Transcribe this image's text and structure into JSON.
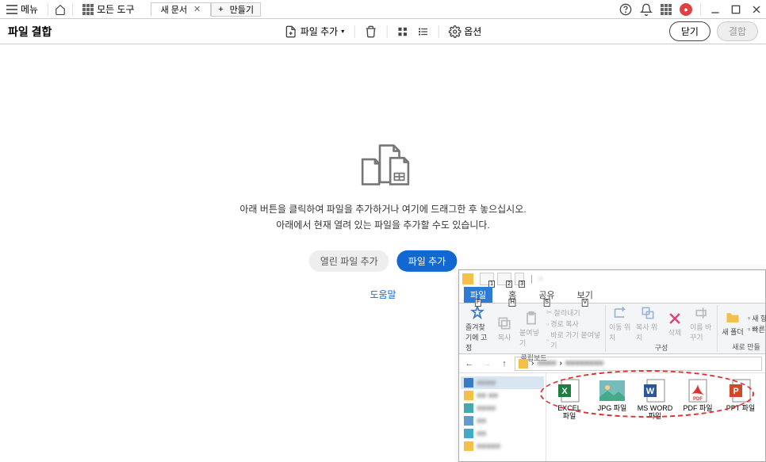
{
  "menubar": {
    "menu_label": "메뉴",
    "all_tools": "모든 도구",
    "tab_active": "새 문서",
    "tab_add": "만들기"
  },
  "toolbar": {
    "title": "파일 결합",
    "add_file": "파일 추가",
    "options": "옵션",
    "close": "닫기",
    "combine": "결합"
  },
  "empty": {
    "line1": "아래 버튼을 클릭하여 파일을 추가하거나 여기에 드래그한 후 놓으십시오.",
    "line2": "아래에서 현재 열려 있는 파일을 추가할 수도 있습니다.",
    "open_files": "열린 파일 추가",
    "add_file": "파일 추가",
    "help": "도움말"
  },
  "explorer": {
    "qat_keys": [
      "1",
      "2",
      "3"
    ],
    "title_sep": "|",
    "ribbon_tabs": {
      "file": "파일",
      "home": "홈",
      "share": "공유",
      "view": "보기",
      "keys": [
        "F",
        "H",
        "S",
        "V"
      ]
    },
    "ribbon": {
      "pin": "즐겨찾기에 고정",
      "copy": "복사",
      "paste": "붙여넣기",
      "cut": "잘라내기",
      "copy_path": "경로 복사",
      "paste_shortcut": "바로 가기 붙여넣기",
      "clipboard_group": "클립보드",
      "move_to": "이동 위치",
      "copy_to": "복사 위치",
      "delete": "삭제",
      "rename": "이름 바꾸기",
      "organize_group": "구성",
      "new_folder": "새 폴더",
      "new_item": "새 항",
      "quick": "빠른",
      "new_group": "새로 만들"
    },
    "files": [
      {
        "name": "EXCEL 파일",
        "type": "excel"
      },
      {
        "name": "JPG 파일",
        "type": "jpg"
      },
      {
        "name": "MS WORD 파일",
        "type": "word"
      },
      {
        "name": "PDF 파일",
        "type": "pdf"
      },
      {
        "name": "PPT 파일",
        "type": "ppt"
      }
    ]
  }
}
